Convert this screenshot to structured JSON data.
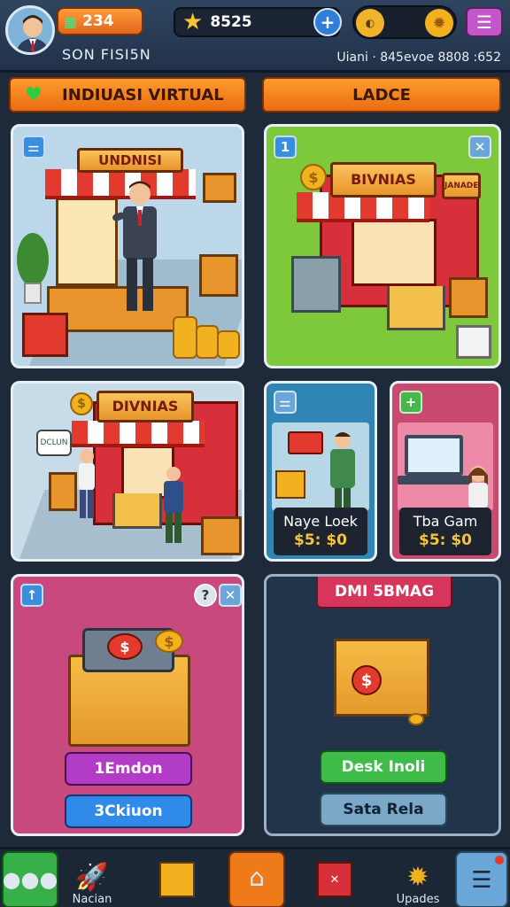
{
  "hud": {
    "player_name": "SON FISI5N",
    "gems": "234",
    "stars": "8525",
    "info": "Uiani · 845evoe 8808 :652"
  },
  "tabs": {
    "left": "INDIUASI VIRTUAL",
    "right": "LADCE"
  },
  "cards": {
    "top_left_sign": "UNDNISI",
    "top_right_sign": "BIVNIAS",
    "top_right_side_sign": "JANADE",
    "mid_left_sign": "DIVNIAS",
    "mid_left_bubble": "DCLUN",
    "small_a": {
      "title": "Naye Loek",
      "price": "$5: $0"
    },
    "small_b": {
      "title": "Tba Gam",
      "price": "$5: $0"
    },
    "bottom_left_button_1": "1Emdon",
    "bottom_left_button_2": "3Ckiuon",
    "bottom_right_banner": "DMI 5BMAG",
    "bottom_right_button_1": "Desk Inoli",
    "bottom_right_button_2": "Sata Rela",
    "top_right_badge": "1"
  },
  "nav": {
    "item_2": "Nacian",
    "item_6": "Upades"
  },
  "colors": {
    "accent_orange": "#ef7a1a",
    "card_green": "#7ec83c",
    "card_pink": "#d04d7a",
    "card_dark": "#22344a"
  }
}
